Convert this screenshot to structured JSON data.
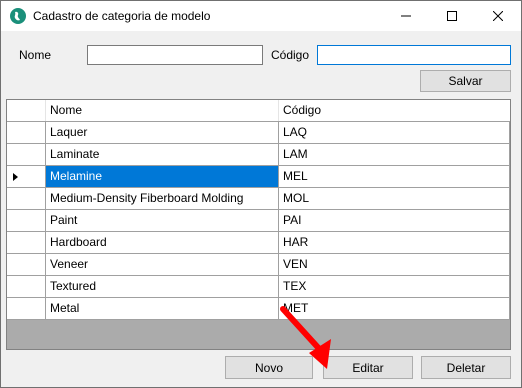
{
  "window": {
    "title": "Cadastro de categoria de modelo",
    "icon": "app-globe-icon",
    "controls": [
      "minimize-icon",
      "maximize-icon",
      "close-icon"
    ]
  },
  "form": {
    "nome_label": "Nome",
    "nome_value": "",
    "codigo_label": "Código",
    "codigo_value": "",
    "save_label": "Salvar"
  },
  "grid": {
    "columns": [
      "Nome",
      "Código"
    ],
    "rows": [
      {
        "nome": "Laquer",
        "codigo": "LAQ"
      },
      {
        "nome": "Laminate",
        "codigo": "LAM"
      },
      {
        "nome": "Melamine",
        "codigo": "MEL"
      },
      {
        "nome": "Medium-Density Fiberboard Molding",
        "codigo": "MOL"
      },
      {
        "nome": "Paint",
        "codigo": "PAI"
      },
      {
        "nome": "Hardboard",
        "codigo": "HAR"
      },
      {
        "nome": "Veneer",
        "codigo": "VEN"
      },
      {
        "nome": "Textured",
        "codigo": "TEX"
      },
      {
        "nome": "Metal",
        "codigo": "MET"
      }
    ],
    "selected_row": 2
  },
  "actions": {
    "new_label": "Novo",
    "edit_label": "Editar",
    "delete_label": "Deletar"
  },
  "colors": {
    "selection": "#0078d7",
    "annotation_arrow": "#ff0000"
  }
}
